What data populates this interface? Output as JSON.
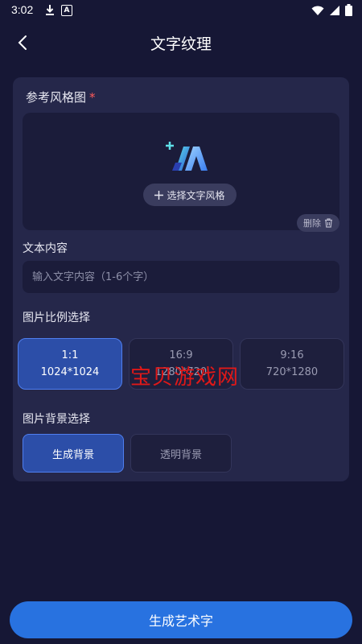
{
  "status": {
    "time": "3:02"
  },
  "header": {
    "title": "文字纹理"
  },
  "reference": {
    "label": "参考风格图",
    "required_mark": "*",
    "select_button": "选择文字风格",
    "delete_label": "删除"
  },
  "text_content": {
    "label": "文本内容",
    "placeholder": "输入文字内容（1-6个字）"
  },
  "ratio": {
    "label": "图片比例选择",
    "options": [
      {
        "ratio": "1:1",
        "size": "1024*1024"
      },
      {
        "ratio": "16:9",
        "size": "1280*720"
      },
      {
        "ratio": "9:16",
        "size": "720*1280"
      }
    ]
  },
  "background": {
    "label": "图片背景选择",
    "options": [
      "生成背景",
      "透明背景"
    ]
  },
  "watermark": "宝贝游戏网",
  "generate_button": "生成艺术字",
  "colors": {
    "accent": "#2872e0",
    "selected": "#2c4ea8",
    "required": "#ff5a5a",
    "watermark": "#e01818"
  }
}
